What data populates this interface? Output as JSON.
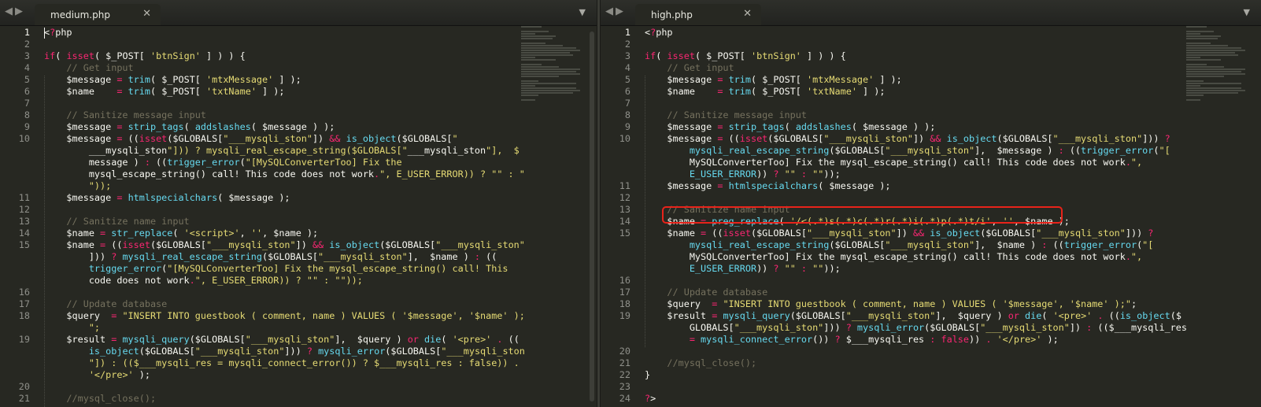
{
  "left": {
    "tab_title": "medium.php",
    "lines": [
      {
        "n": "1",
        "t": "<?php"
      },
      {
        "n": "2",
        "t": ""
      },
      {
        "n": "3",
        "t": "if( isset( $_POST[ 'btnSign' ] ) ) {"
      },
      {
        "n": "4",
        "t": "    // Get input"
      },
      {
        "n": "5",
        "t": "    $message = trim( $_POST[ 'mtxMessage' ] );"
      },
      {
        "n": "6",
        "t": "    $name    = trim( $_POST[ 'txtName' ] );"
      },
      {
        "n": "7",
        "t": ""
      },
      {
        "n": "8",
        "t": "    // Sanitize message input"
      },
      {
        "n": "9",
        "t": "    $message = strip_tags( addslashes( $message ) );"
      },
      {
        "n": "10",
        "t": "    $message = ((isset($GLOBALS[\"___mysqli_ston\"]) && is_object($GLOBALS[\""
      },
      {
        "n": "",
        "t": "        ___mysqli_ston\"])) ? mysqli_real_escape_string($GLOBALS[\"___mysqli_ston\"],  $"
      },
      {
        "n": "",
        "t": "        message ) : ((trigger_error(\"[MySQLConverterToo] Fix the"
      },
      {
        "n": "",
        "t": "        mysql_escape_string() call! This code does not work.\", E_USER_ERROR)) ? \"\" : \""
      },
      {
        "n": "",
        "t": "        \"));"
      },
      {
        "n": "11",
        "t": "    $message = htmlspecialchars( $message );"
      },
      {
        "n": "12",
        "t": ""
      },
      {
        "n": "13",
        "t": "    // Sanitize name input"
      },
      {
        "n": "14",
        "t": "    $name = str_replace( '<script>', '', $name );"
      },
      {
        "n": "15",
        "t": "    $name = ((isset($GLOBALS[\"___mysqli_ston\"]) && is_object($GLOBALS[\"___mysqli_ston\""
      },
      {
        "n": "",
        "t": "        ])) ? mysqli_real_escape_string($GLOBALS[\"___mysqli_ston\"],  $name ) : (("
      },
      {
        "n": "",
        "t": "        trigger_error(\"[MySQLConverterToo] Fix the mysql_escape_string() call! This"
      },
      {
        "n": "",
        "t": "        code does not work.\", E_USER_ERROR)) ? \"\" : \"\"));"
      },
      {
        "n": "16",
        "t": ""
      },
      {
        "n": "17",
        "t": "    // Update database"
      },
      {
        "n": "18",
        "t": "    $query  = \"INSERT INTO guestbook ( comment, name ) VALUES ( '$message', '$name' );"
      },
      {
        "n": "",
        "t": "        \";"
      },
      {
        "n": "19",
        "t": "    $result = mysqli_query($GLOBALS[\"___mysqli_ston\"],  $query ) or die( '<pre>' . (("
      },
      {
        "n": "",
        "t": "        is_object($GLOBALS[\"___mysqli_ston\"])) ? mysqli_error($GLOBALS[\"___mysqli_ston"
      },
      {
        "n": "",
        "t": "        \"]) : (($___mysqli_res = mysqli_connect_error()) ? $___mysqli_res : false)) ."
      },
      {
        "n": "",
        "t": "        '</pre>' );"
      },
      {
        "n": "20",
        "t": ""
      },
      {
        "n": "21",
        "t": "    //mysql_close();"
      }
    ]
  },
  "right": {
    "tab_title": "high.php",
    "lines": [
      {
        "n": "1",
        "t": "<?php"
      },
      {
        "n": "2",
        "t": ""
      },
      {
        "n": "3",
        "t": "if( isset( $_POST[ 'btnSign' ] ) ) {"
      },
      {
        "n": "4",
        "t": "    // Get input"
      },
      {
        "n": "5",
        "t": "    $message = trim( $_POST[ 'mtxMessage' ] );"
      },
      {
        "n": "6",
        "t": "    $name    = trim( $_POST[ 'txtName' ] );"
      },
      {
        "n": "7",
        "t": ""
      },
      {
        "n": "8",
        "t": "    // Sanitize message input"
      },
      {
        "n": "9",
        "t": "    $message = strip_tags( addslashes( $message ) );"
      },
      {
        "n": "10",
        "t": "    $message = ((isset($GLOBALS[\"___mysqli_ston\"]) && is_object($GLOBALS[\"___mysqli_ston\"])) ?"
      },
      {
        "n": "",
        "t": "        mysqli_real_escape_string($GLOBALS[\"___mysqli_ston\"],  $message ) : ((trigger_error(\"["
      },
      {
        "n": "",
        "t": "        MySQLConverterToo] Fix the mysql_escape_string() call! This code does not work.\","
      },
      {
        "n": "",
        "t": "        E_USER_ERROR)) ? \"\" : \"\"));"
      },
      {
        "n": "11",
        "t": "    $message = htmlspecialchars( $message );"
      },
      {
        "n": "12",
        "t": ""
      },
      {
        "n": "13",
        "t": "    // Sanitize name input"
      },
      {
        "n": "14",
        "t": "    $name = preg_replace( '/<(.*)s(.*)c(.*)r(.*)i(.*)p(.*)t/i', '', $name );"
      },
      {
        "n": "15",
        "t": "    $name = ((isset($GLOBALS[\"___mysqli_ston\"]) && is_object($GLOBALS[\"___mysqli_ston\"])) ?"
      },
      {
        "n": "",
        "t": "        mysqli_real_escape_string($GLOBALS[\"___mysqli_ston\"],  $name ) : ((trigger_error(\"["
      },
      {
        "n": "",
        "t": "        MySQLConverterToo] Fix the mysql_escape_string() call! This code does not work.\","
      },
      {
        "n": "",
        "t": "        E_USER_ERROR)) ? \"\" : \"\"));"
      },
      {
        "n": "16",
        "t": ""
      },
      {
        "n": "17",
        "t": "    // Update database"
      },
      {
        "n": "18",
        "t": "    $query  = \"INSERT INTO guestbook ( comment, name ) VALUES ( '$message', '$name' );\";"
      },
      {
        "n": "19",
        "t": "    $result = mysqli_query($GLOBALS[\"___mysqli_ston\"],  $query ) or die( '<pre>' . ((is_object($"
      },
      {
        "n": "",
        "t": "        GLOBALS[\"___mysqli_ston\"])) ? mysqli_error($GLOBALS[\"___mysqli_ston\"]) : (($___mysqli_res"
      },
      {
        "n": "",
        "t": "        = mysqli_connect_error()) ? $___mysqli_res : false)) . '</pre>' );"
      },
      {
        "n": "20",
        "t": ""
      },
      {
        "n": "21",
        "t": "    //mysql_close();"
      },
      {
        "n": "22",
        "t": "}"
      },
      {
        "n": "23",
        "t": ""
      },
      {
        "n": "24",
        "t": "?>"
      }
    ]
  },
  "syntax_colors": {
    "keyword": "#f92672",
    "function": "#66d9ef",
    "string": "#e6db74",
    "comment": "#75715e",
    "constant": "#ae81ff",
    "text": "#f8f8f2",
    "background": "#272822"
  },
  "highlight_color": "#e8231a",
  "icons": {
    "back": "left-arrow",
    "forward": "right-arrow",
    "close": "x",
    "menu": "down-triangle"
  }
}
